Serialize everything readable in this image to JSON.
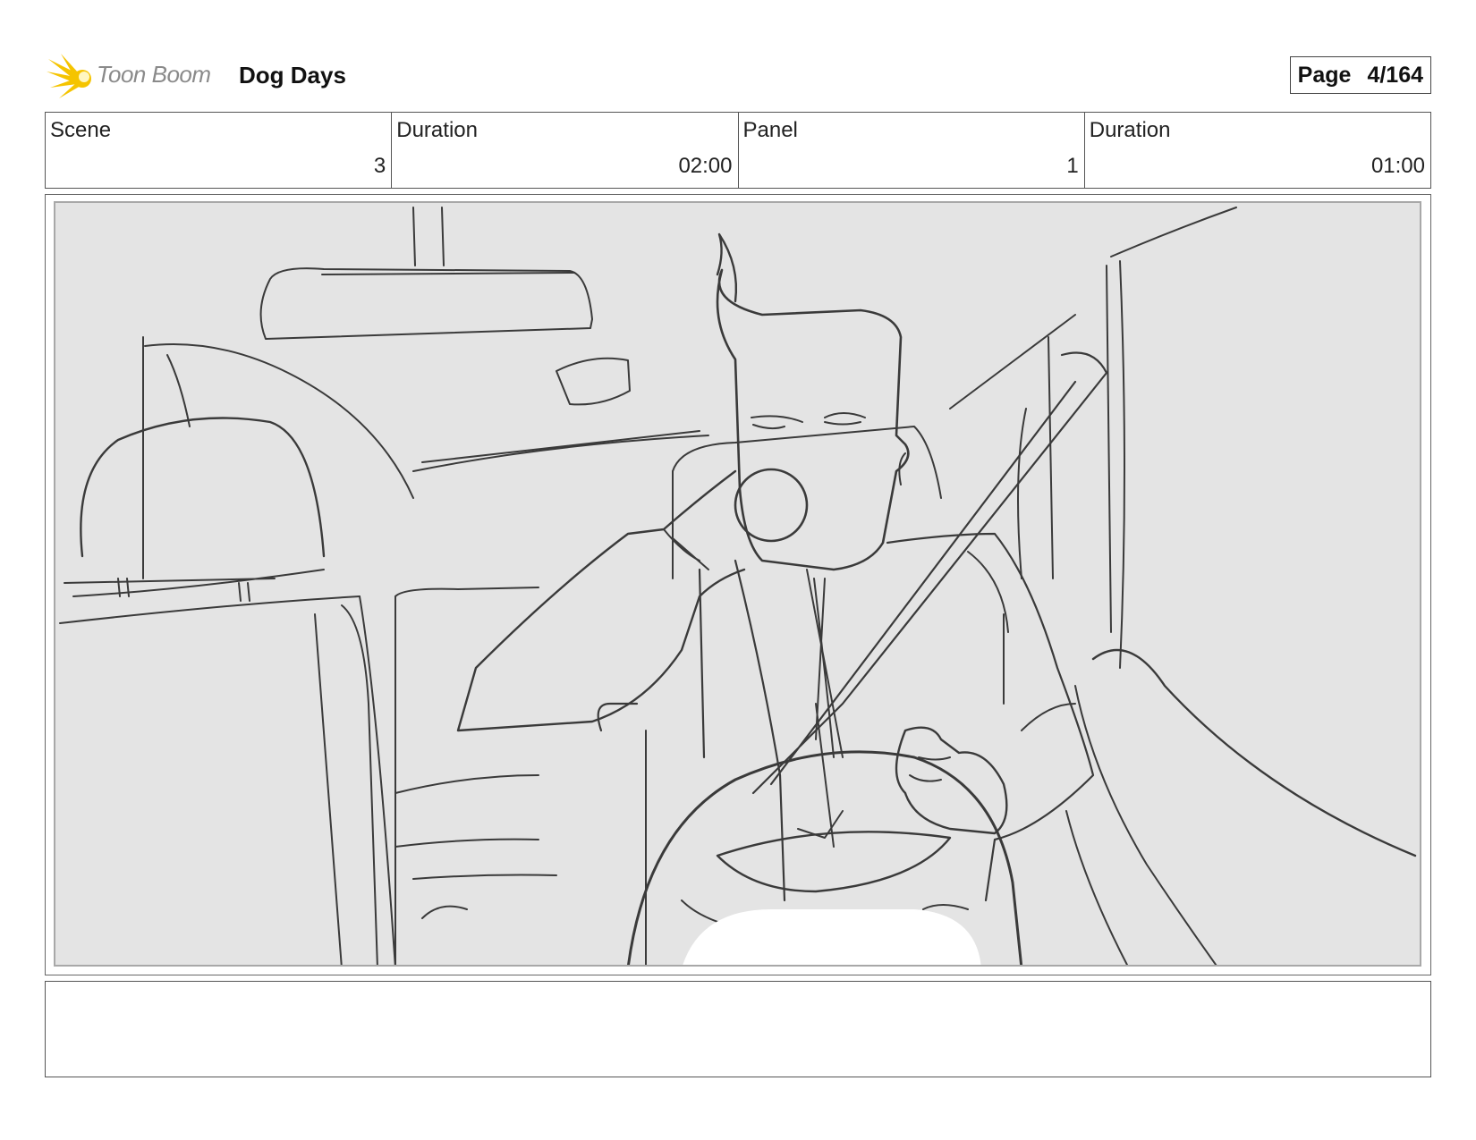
{
  "header": {
    "logo_text": "Toon Boom",
    "project_title": "Dog Days",
    "page_label": "Page",
    "page_value": "4/164"
  },
  "info": [
    {
      "label": "Scene",
      "value": "3"
    },
    {
      "label": "Duration",
      "value": "02:00"
    },
    {
      "label": "Panel",
      "value": "1"
    },
    {
      "label": "Duration",
      "value": "01:00"
    }
  ],
  "notes": {
    "text": ""
  },
  "colors": {
    "logo_accent": "#f5c400",
    "panel_background": "#e4e4e4",
    "sketch_stroke": "#2a2a2a"
  },
  "icons": {
    "logo": "toon-boom-starburst-icon"
  }
}
